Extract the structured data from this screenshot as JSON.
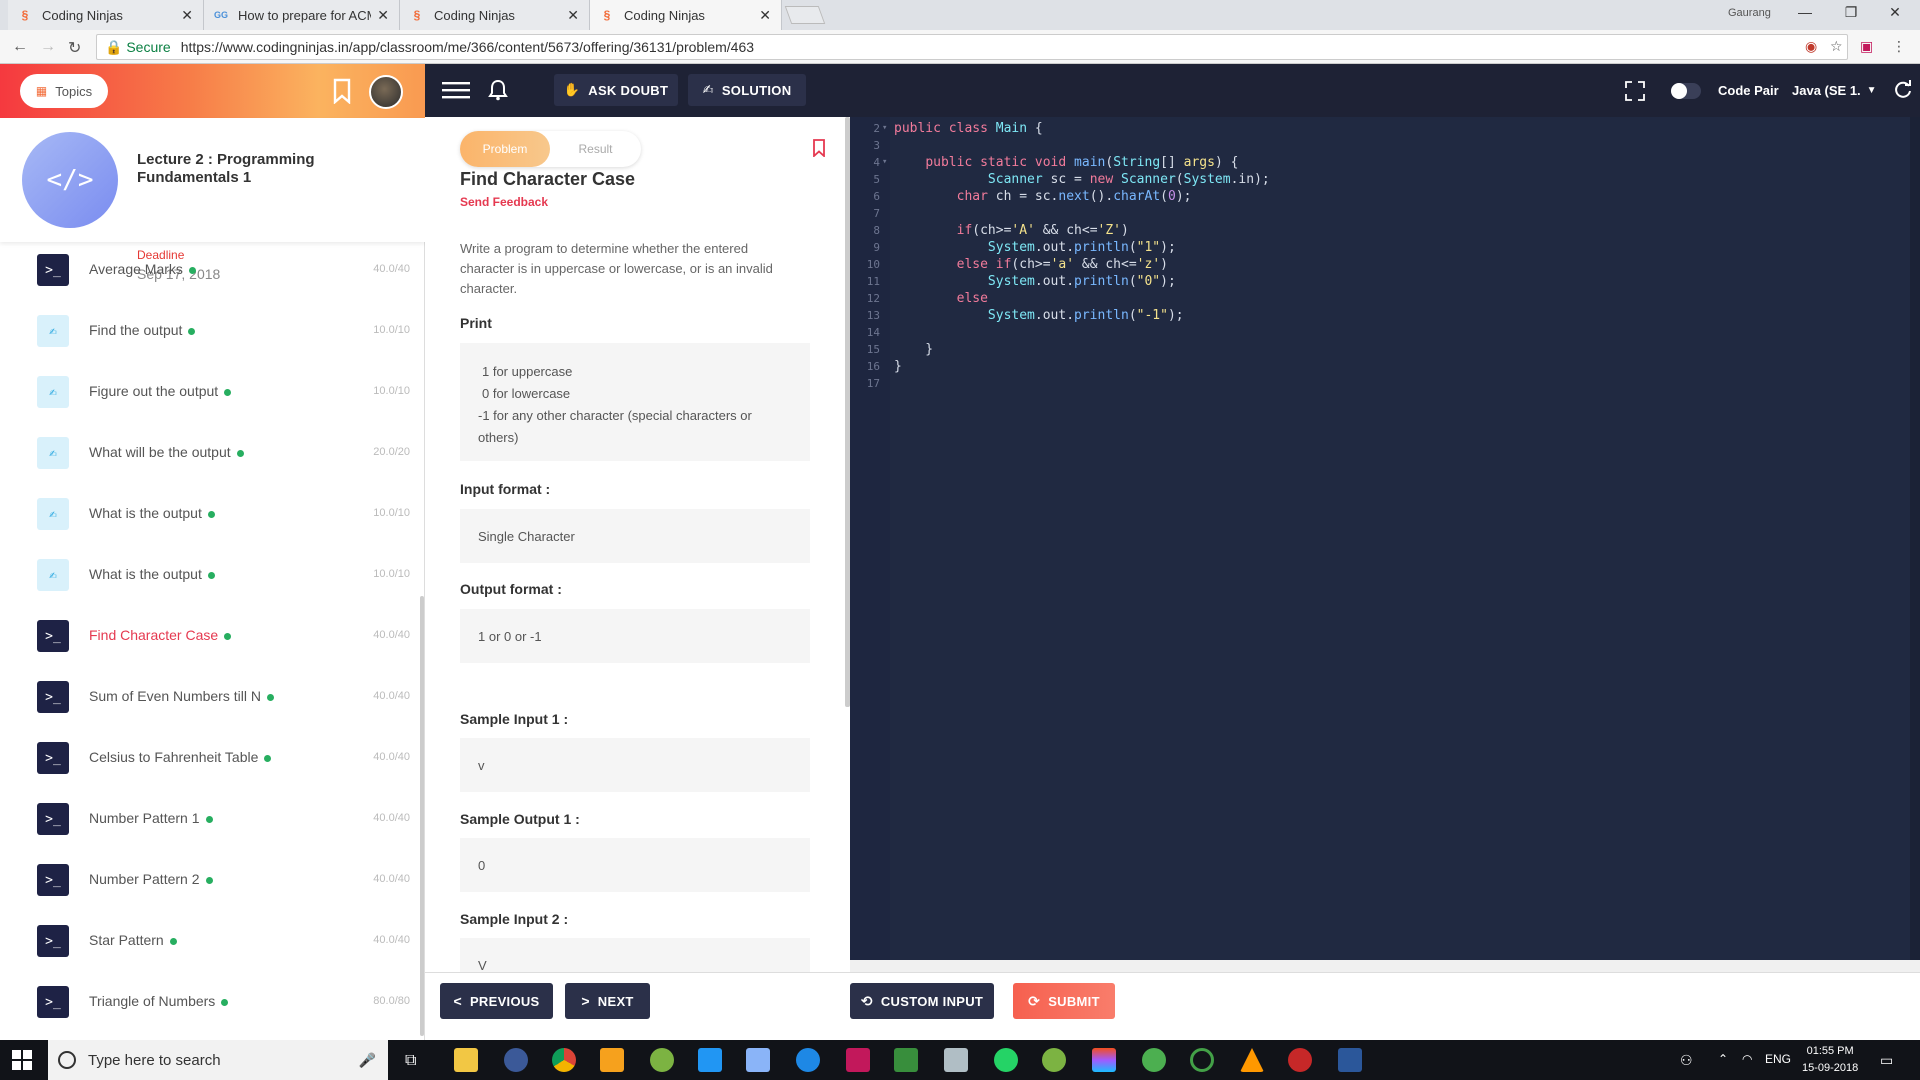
{
  "browser": {
    "tabs": [
      {
        "title": "Coding Ninjas",
        "icon": "coding-ninjas-icon",
        "active": false
      },
      {
        "title": "How to prepare for ACM",
        "icon": "site-icon",
        "active": false
      },
      {
        "title": "Coding Ninjas",
        "icon": "coding-ninjas-icon",
        "active": false
      },
      {
        "title": "Coding Ninjas",
        "icon": "coding-ninjas-icon",
        "active": true
      }
    ],
    "profile_name": "Gaurang",
    "secure_label": "Secure",
    "url": "https://www.codingninjas.in/app/classroom/me/366/content/5673/offering/36131/problem/463"
  },
  "sidebar": {
    "topics_label": "Topics",
    "lecture_title": "Lecture 2 : Programming Fundamentals 1",
    "deadline_label": "Deadline",
    "deadline_date": "Sep 17, 2018",
    "problems": [
      {
        "name": "Average Marks",
        "score": "40.0/40",
        "type": "code",
        "active": false
      },
      {
        "name": "Find the output",
        "score": "10.0/10",
        "type": "mcq",
        "active": false
      },
      {
        "name": "Figure out the output",
        "score": "10.0/10",
        "type": "mcq",
        "active": false
      },
      {
        "name": "What will be the output",
        "score": "20.0/20",
        "type": "mcq",
        "active": false
      },
      {
        "name": "What is the output",
        "score": "10.0/10",
        "type": "mcq",
        "active": false
      },
      {
        "name": "What is the output",
        "score": "10.0/10",
        "type": "mcq",
        "active": false
      },
      {
        "name": "Find Character Case",
        "score": "40.0/40",
        "type": "code",
        "active": true
      },
      {
        "name": "Sum of Even Numbers till N",
        "score": "40.0/40",
        "type": "code",
        "active": false
      },
      {
        "name": "Celsius to Fahrenheit Table",
        "score": "40.0/40",
        "type": "code",
        "active": false
      },
      {
        "name": "Number Pattern 1",
        "score": "40.0/40",
        "type": "code",
        "active": false
      },
      {
        "name": "Number Pattern 2",
        "score": "40.0/40",
        "type": "code",
        "active": false
      },
      {
        "name": "Star Pattern",
        "score": "40.0/40",
        "type": "code",
        "active": false
      },
      {
        "name": "Triangle of Numbers",
        "score": "80.0/80",
        "type": "code",
        "active": false
      }
    ]
  },
  "toolbar": {
    "ask_doubt": "ASK DOUBT",
    "solution": "SOLUTION",
    "code_pair": "Code Pair",
    "language": "Java (SE 1."
  },
  "problem": {
    "tab_problem": "Problem",
    "tab_result": "Result",
    "title": "Find Character Case",
    "send_feedback": "Send Feedback",
    "description": "Write a program to determine whether the entered character is in uppercase or lowercase, or is an invalid character.",
    "print_label": "Print",
    "print_lines": [
      "1 for uppercase",
      "0 for lowercase",
      "-1 for any other character (special characters or others)"
    ],
    "input_format_label": "Input format :",
    "input_format": "Single Character",
    "output_format_label": "Output format :",
    "output_format": "1 or 0 or -1",
    "sample_input_1_label": "Sample Input 1 :",
    "sample_input_1": "v",
    "sample_output_1_label": "Sample Output 1 :",
    "sample_output_1": "0",
    "sample_input_2_label": "Sample Input 2 :",
    "sample_input_2": "V"
  },
  "editor": {
    "lines": [
      {
        "n": "2",
        "segs": [
          [
            "kw",
            "public "
          ],
          [
            "kw",
            "class "
          ],
          [
            "ty",
            "Main"
          ],
          [
            "pl",
            " {"
          ]
        ]
      },
      {
        "n": "3",
        "segs": []
      },
      {
        "n": "4",
        "segs": [
          [
            "pl",
            "    "
          ],
          [
            "kw",
            "public "
          ],
          [
            "kw",
            "static "
          ],
          [
            "kw",
            "void "
          ],
          [
            "fn",
            "main"
          ],
          [
            "pl",
            "("
          ],
          [
            "ty",
            "String"
          ],
          [
            "pl",
            "[] "
          ],
          [
            "st",
            "args"
          ],
          [
            "pl",
            ") {"
          ]
        ]
      },
      {
        "n": "5",
        "segs": [
          [
            "pl",
            "            "
          ],
          [
            "ty",
            "Scanner"
          ],
          [
            "pl",
            " sc = "
          ],
          [
            "kw",
            "new "
          ],
          [
            "ty",
            "Scanner"
          ],
          [
            "pl",
            "("
          ],
          [
            "ty",
            "System"
          ],
          [
            "pl",
            ".in);"
          ]
        ]
      },
      {
        "n": "6",
        "segs": [
          [
            "pl",
            "        "
          ],
          [
            "kw",
            "char "
          ],
          [
            "pl",
            "ch = sc."
          ],
          [
            "fn",
            "next"
          ],
          [
            "pl",
            "()."
          ],
          [
            "fn",
            "charAt"
          ],
          [
            "pl",
            "("
          ],
          [
            "nm",
            "0"
          ],
          [
            "pl",
            ");"
          ]
        ]
      },
      {
        "n": "7",
        "segs": []
      },
      {
        "n": "8",
        "segs": [
          [
            "pl",
            "        "
          ],
          [
            "kw",
            "if"
          ],
          [
            "pl",
            "(ch>="
          ],
          [
            "st",
            "'A'"
          ],
          [
            "pl",
            " && ch<="
          ],
          [
            "st",
            "'Z'"
          ],
          [
            "pl",
            ")"
          ]
        ]
      },
      {
        "n": "9",
        "segs": [
          [
            "pl",
            "            "
          ],
          [
            "ty",
            "System"
          ],
          [
            "pl",
            ".out."
          ],
          [
            "fn",
            "println"
          ],
          [
            "pl",
            "("
          ],
          [
            "st",
            "\"1\""
          ],
          [
            "pl",
            ");"
          ]
        ]
      },
      {
        "n": "10",
        "segs": [
          [
            "pl",
            "        "
          ],
          [
            "kw",
            "else if"
          ],
          [
            "pl",
            "(ch>="
          ],
          [
            "st",
            "'a'"
          ],
          [
            "pl",
            " && ch<="
          ],
          [
            "st",
            "'z'"
          ],
          [
            "pl",
            ")"
          ]
        ]
      },
      {
        "n": "11",
        "segs": [
          [
            "pl",
            "            "
          ],
          [
            "ty",
            "System"
          ],
          [
            "pl",
            ".out."
          ],
          [
            "fn",
            "println"
          ],
          [
            "pl",
            "("
          ],
          [
            "st",
            "\"0\""
          ],
          [
            "pl",
            ");"
          ]
        ]
      },
      {
        "n": "12",
        "segs": [
          [
            "pl",
            "        "
          ],
          [
            "kw",
            "else"
          ]
        ]
      },
      {
        "n": "13",
        "segs": [
          [
            "pl",
            "            "
          ],
          [
            "ty",
            "System"
          ],
          [
            "pl",
            ".out."
          ],
          [
            "fn",
            "println"
          ],
          [
            "pl",
            "("
          ],
          [
            "st",
            "\"-1\""
          ],
          [
            "pl",
            ");"
          ]
        ]
      },
      {
        "n": "14",
        "segs": []
      },
      {
        "n": "15",
        "segs": [
          [
            "pl",
            "    }"
          ]
        ]
      },
      {
        "n": "16",
        "segs": [
          [
            "pl",
            "}"
          ]
        ]
      },
      {
        "n": "17",
        "segs": []
      }
    ]
  },
  "actions": {
    "previous": "PREVIOUS",
    "next": "NEXT",
    "custom_input": "CUSTOM INPUT",
    "submit": "SUBMIT"
  },
  "taskbar": {
    "search_placeholder": "Type here to search",
    "language": "ENG",
    "time": "01:55 PM",
    "date": "15-09-2018"
  }
}
